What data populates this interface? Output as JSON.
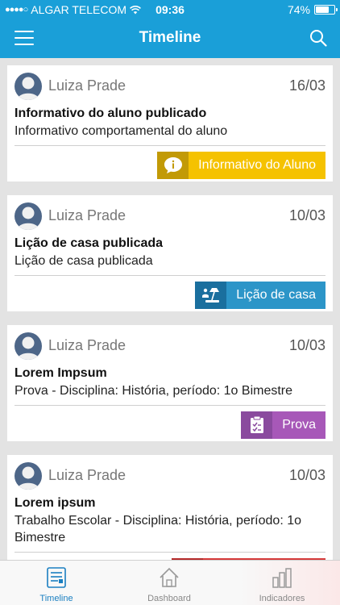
{
  "status_bar": {
    "signal": "●●●●○",
    "carrier": "ALGAR TELECOM",
    "time": "09:36",
    "battery": "74%",
    "battery_level": 0.74
  },
  "nav": {
    "title": "Timeline"
  },
  "feed": [
    {
      "author": "Luiza Prade",
      "date": "16/03",
      "title": "Informativo do aluno publicado",
      "description": "Informativo comportamental do aluno",
      "tag": {
        "label": "Informativo do Aluno",
        "icon": "info-speech-icon",
        "icon_bg": "#c29a06",
        "label_bg": "#f5c200"
      }
    },
    {
      "author": "Luiza Prade",
      "date": "10/03",
      "title": "Lição de casa publicada",
      "description": "Lição de casa publicada",
      "tag": {
        "label": "Lição de casa",
        "icon": "study-lamp-icon",
        "icon_bg": "#1a6f9e",
        "label_bg": "#2c95c8"
      }
    },
    {
      "author": "Luiza Prade",
      "date": "10/03",
      "title": "Lorem Impsum",
      "description": "Prova - Disciplina: História, período: 1o Bimestre",
      "tag": {
        "label": "Prova",
        "icon": "exam-clipboard-icon",
        "icon_bg": "#8a4a9e",
        "label_bg": "#a758b8"
      }
    },
    {
      "author": "Luiza Prade",
      "date": "10/03",
      "title": "Lorem ipsum",
      "description": "Trabalho Escolar - Disciplina: História, período: 1o Bimestre",
      "tag": {
        "label": "",
        "icon": "",
        "icon_bg": "#b52a2a",
        "label_bg": "#d63a3a"
      }
    }
  ],
  "tab_bar": {
    "tabs": [
      {
        "label": "Timeline",
        "icon": "timeline-icon",
        "active": true
      },
      {
        "label": "Dashboard",
        "icon": "home-icon",
        "active": false
      },
      {
        "label": "Indicadores",
        "icon": "bar-chart-icon",
        "active": false
      }
    ],
    "active_color": "#1a7fc1"
  }
}
